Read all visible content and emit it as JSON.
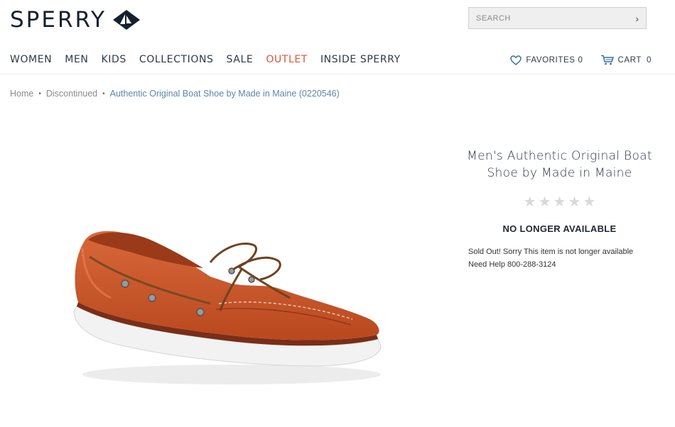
{
  "brand": {
    "logo_text": "SPERRY",
    "logo_icon": "sail-diamond-icon"
  },
  "search": {
    "placeholder": "SEARCH"
  },
  "nav": {
    "items": [
      "WOMEN",
      "MEN",
      "KIDS",
      "COLLECTIONS",
      "SALE",
      "OUTLET",
      "INSIDE SPERRY"
    ],
    "highlight_color": "#d9553c"
  },
  "utility": {
    "favorites_label": "FAVORITES",
    "favorites_count": "0",
    "cart_label": "CART",
    "cart_count": "0"
  },
  "breadcrumb": [
    "Home",
    "Discontinued",
    "Authentic Original Boat Shoe by Made in Maine (0220546)"
  ],
  "product": {
    "title": "Men's Authentic Original Boat Shoe by Made in Maine",
    "rating": 0,
    "max_rating": 5,
    "status": "NO LONGER AVAILABLE",
    "sold_out_text": "Sold Out! Sorry This item is not longer available",
    "help_text": "Need Help 800-288-3124",
    "image_icon": "boat-shoe-image"
  },
  "colors": {
    "brand_navy": "#16202e",
    "link_blue": "#5f85a6",
    "shoe_leather": "#c8562c"
  }
}
